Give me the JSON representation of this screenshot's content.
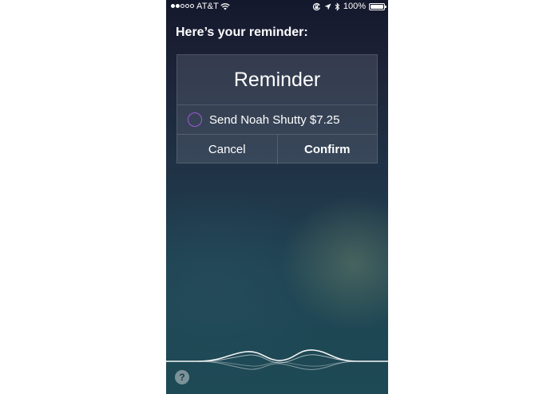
{
  "status_bar": {
    "carrier": "AT&T",
    "signal_bars_filled": 2,
    "signal_bars_total": 5,
    "battery_percent": "100%"
  },
  "siri": {
    "prompt": "Here’s your reminder:"
  },
  "reminder_card": {
    "title": "Reminder",
    "item_text": "Send Noah Shutty $7.25",
    "checkbox_color": "#a255d8",
    "cancel_label": "Cancel",
    "confirm_label": "Confirm"
  },
  "help": {
    "label": "?"
  },
  "icons": [
    "wifi-icon",
    "orientation-lock-icon",
    "location-arrow-icon",
    "bluetooth-icon",
    "battery-icon",
    "siri-waveform-icon",
    "help-icon"
  ]
}
